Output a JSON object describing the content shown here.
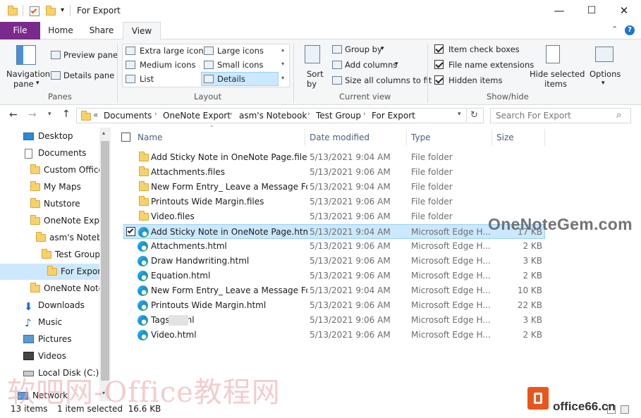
{
  "window": {
    "title": "For Export",
    "minimize_glyph": "—",
    "maximize_glyph": "☐",
    "close_glyph": "✕"
  },
  "tabs": [
    {
      "label": "File"
    },
    {
      "label": "Home"
    },
    {
      "label": "Share"
    },
    {
      "label": "View"
    }
  ],
  "ribbon": {
    "panes": {
      "navigation_pane": "Navigation\npane",
      "nav_pane_line1": "Navigation",
      "nav_pane_line2": "pane",
      "preview_pane": "Preview pane",
      "details_pane": "Details pane",
      "group": "Panes"
    },
    "layout": {
      "items": [
        "Extra large icons",
        "Large icons",
        "Medium icons",
        "Small icons",
        "List",
        "Details"
      ],
      "selected": "Details",
      "group": "Layout"
    },
    "current_view": {
      "sort_line1": "Sort",
      "sort_line2": "by",
      "group_by": "Group by",
      "add_columns": "Add columns",
      "size_all_columns": "Size all columns to fit",
      "group": "Current view"
    },
    "show_hide": {
      "item_check_boxes": "Item check boxes",
      "file_name_extensions": "File name extensions",
      "hidden_items": "Hidden items",
      "item_check_boxes_checked": true,
      "file_name_extensions_checked": true,
      "hidden_items_checked": true,
      "hide_selected_line1": "Hide selected",
      "hide_selected_line2": "items",
      "options": "Options",
      "group": "Show/hide"
    }
  },
  "address": {
    "overflow": "«",
    "crumbs": [
      "Documents",
      "OneNote Export",
      "asm's Notebook",
      "Test Group",
      "For Export"
    ],
    "search_placeholder": "Search For Export"
  },
  "nav_pane": [
    {
      "label": "Desktop",
      "icon": "desktop-icon"
    },
    {
      "label": "Documents",
      "icon": "documents-icon"
    },
    {
      "label": "Custom Office",
      "icon": "folder-icon"
    },
    {
      "label": "My Maps",
      "icon": "folder-icon"
    },
    {
      "label": "Nutstore",
      "icon": "folder-icon"
    },
    {
      "label": "OneNote Expo",
      "icon": "folder-icon"
    },
    {
      "label": "asm's Notebo",
      "icon": "folder-icon"
    },
    {
      "label": "Test Group",
      "icon": "folder-icon"
    },
    {
      "label": "For Export",
      "icon": "folder-icon",
      "selected": true
    },
    {
      "label": "OneNote Note",
      "icon": "folder-icon"
    },
    {
      "label": "Downloads",
      "icon": "downloads-icon"
    },
    {
      "label": "Music",
      "icon": "music-icon"
    },
    {
      "label": "Pictures",
      "icon": "pictures-icon"
    },
    {
      "label": "Videos",
      "icon": "videos-icon"
    },
    {
      "label": "Local Disk (C:)",
      "icon": "disk-icon"
    },
    {
      "label": "Network",
      "icon": "network-icon"
    }
  ],
  "columns": {
    "name": "Name",
    "date": "Date modified",
    "type": "Type",
    "size": "Size"
  },
  "files": [
    {
      "name": "Add Sticky Note in OneNote Page.files",
      "date": "5/13/2021 9:04 AM",
      "type": "File folder",
      "size": "",
      "kind": "folder"
    },
    {
      "name": "Attachments.files",
      "date": "5/13/2021 9:06 AM",
      "type": "File folder",
      "size": "",
      "kind": "folder"
    },
    {
      "name": "New Form Entry_ Leave a Message For...",
      "date": "5/13/2021 9:04 AM",
      "type": "File folder",
      "size": "",
      "kind": "folder"
    },
    {
      "name": "Printouts Wide Margin.files",
      "date": "5/13/2021 9:06 AM",
      "type": "File folder",
      "size": "",
      "kind": "folder"
    },
    {
      "name": "Video.files",
      "date": "5/13/2021 9:06 AM",
      "type": "File folder",
      "size": "",
      "kind": "folder"
    },
    {
      "name": "Add Sticky Note in OneNote Page.html",
      "date": "5/13/2021 9:04 AM",
      "type": "Microsoft Edge H...",
      "size": "17 KB",
      "kind": "html",
      "selected": true
    },
    {
      "name": "Attachments.html",
      "date": "5/13/2021 9:06 AM",
      "type": "Microsoft Edge H...",
      "size": "2 KB",
      "kind": "html"
    },
    {
      "name": "Draw Handwriting.html",
      "date": "5/13/2021 9:06 AM",
      "type": "Microsoft Edge H...",
      "size": "3 KB",
      "kind": "html"
    },
    {
      "name": "Equation.html",
      "date": "5/13/2021 9:06 AM",
      "type": "Microsoft Edge H...",
      "size": "2 KB",
      "kind": "html"
    },
    {
      "name": "New Form Entry_ Leave a Message For...",
      "date": "5/13/2021 9:04 AM",
      "type": "Microsoft Edge H...",
      "size": "10 KB",
      "kind": "html"
    },
    {
      "name": "Printouts Wide Margin.html",
      "date": "5/13/2021 9:06 AM",
      "type": "Microsoft Edge H...",
      "size": "22 KB",
      "kind": "html"
    },
    {
      "name": "Tags        .html",
      "date": "5/13/2021 9:06 AM",
      "type": "Microsoft Edge H...",
      "size": "3 KB",
      "kind": "html"
    },
    {
      "name": "Video.html",
      "date": "5/13/2021 9:06 AM",
      "type": "Microsoft Edge H...",
      "size": "2 KB",
      "kind": "html"
    }
  ],
  "status": {
    "items": "13 items",
    "selection": "1 item selected  16.6 KB"
  },
  "watermarks": {
    "site": "OneNoteGem.com",
    "cn": "软吧网-Office教程网",
    "brand": "office66.cn"
  },
  "colors": {
    "file_tab": "#7a2a8c",
    "selection": "#cce8ff",
    "accent": "#0078d7"
  }
}
